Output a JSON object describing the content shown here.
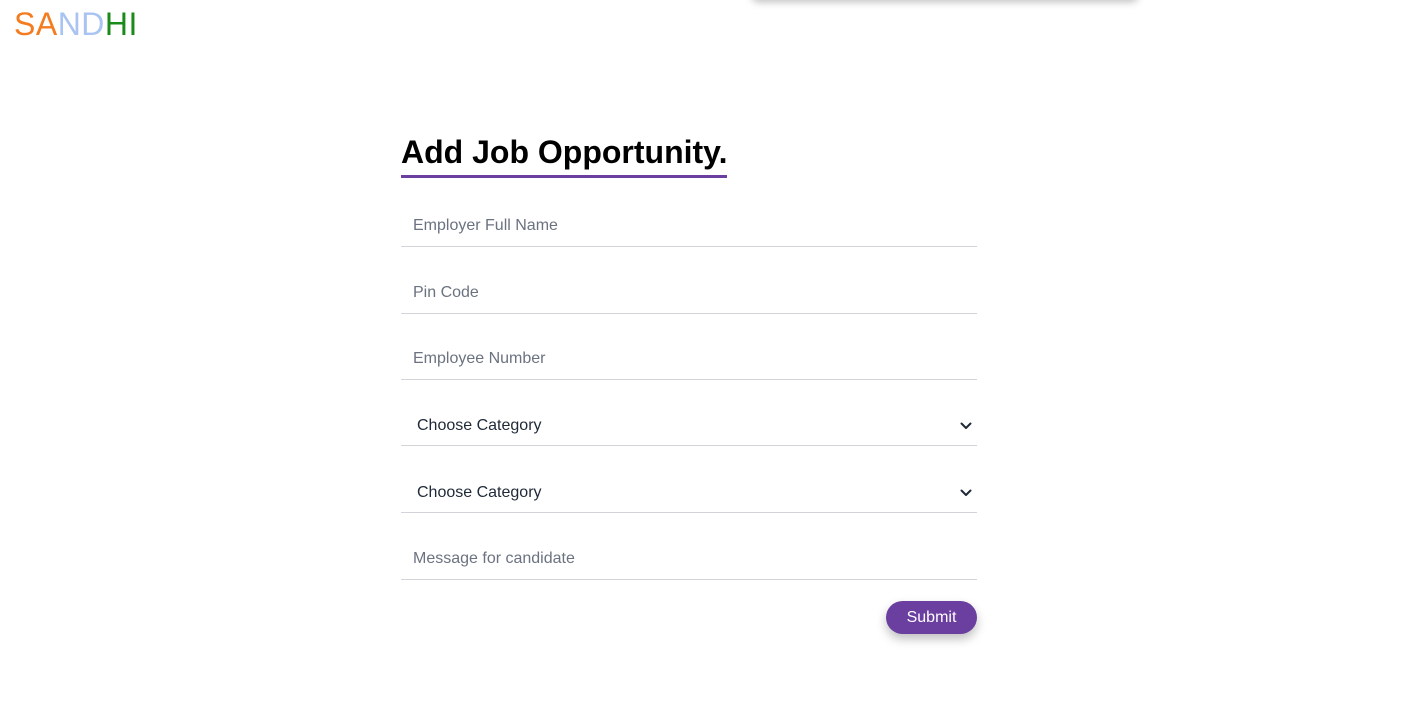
{
  "brand": {
    "letters": [
      {
        "char": "S",
        "color": "#f47c20"
      },
      {
        "char": "A",
        "color": "#f47c20"
      },
      {
        "char": "N",
        "color": "#a9c4f2"
      },
      {
        "char": "D",
        "color": "#a9c4f2"
      },
      {
        "char": "H",
        "color": "#1a8a1a"
      },
      {
        "char": "I",
        "color": "#1a8a1a"
      }
    ]
  },
  "form": {
    "title": "Add Job Opportunity.",
    "accent_color": "#6b3fa0",
    "employer_name_placeholder": "Employer Full Name",
    "pin_code_placeholder": "Pin Code",
    "employee_number_placeholder": "Employee Number",
    "category_1_selected": "Choose Category",
    "category_2_selected": "Choose Category",
    "message_placeholder": "Message for candidate",
    "submit_label": "Submit",
    "chevron_icon": "chevron-down-icon"
  }
}
